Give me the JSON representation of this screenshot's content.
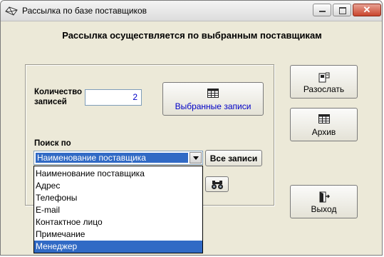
{
  "window": {
    "title": "Рассылка по базе поставщиков",
    "close_glyph": "✕"
  },
  "heading": "Рассылка осуществляется по выбранным поставщикам",
  "count": {
    "label_line1": "Количество",
    "label_line2": "записей",
    "value": "2"
  },
  "buttons": {
    "selected_records": "Выбранные записи",
    "send": "Разослать",
    "archive": "Архив",
    "exit": "Выход",
    "all_records": "Все записи"
  },
  "search": {
    "label": "Поиск по",
    "selected": "Наименование поставщика",
    "options": [
      "Наименование поставщика",
      "Адрес",
      "Телефоны",
      "E-mail",
      "Контактное лицо",
      "Примечание",
      "Менеджер"
    ],
    "highlighted_option": "Менеджер"
  },
  "icons": {
    "title": "mail-envelope-icon",
    "table": "table-grid-icon",
    "send": "send-mail-icon",
    "binoculars": "binoculars-icon",
    "exit": "door-exit-icon"
  },
  "colors": {
    "highlight": "#316ac5",
    "count_value": "#0000c8",
    "selected_label": "#0000c8"
  }
}
